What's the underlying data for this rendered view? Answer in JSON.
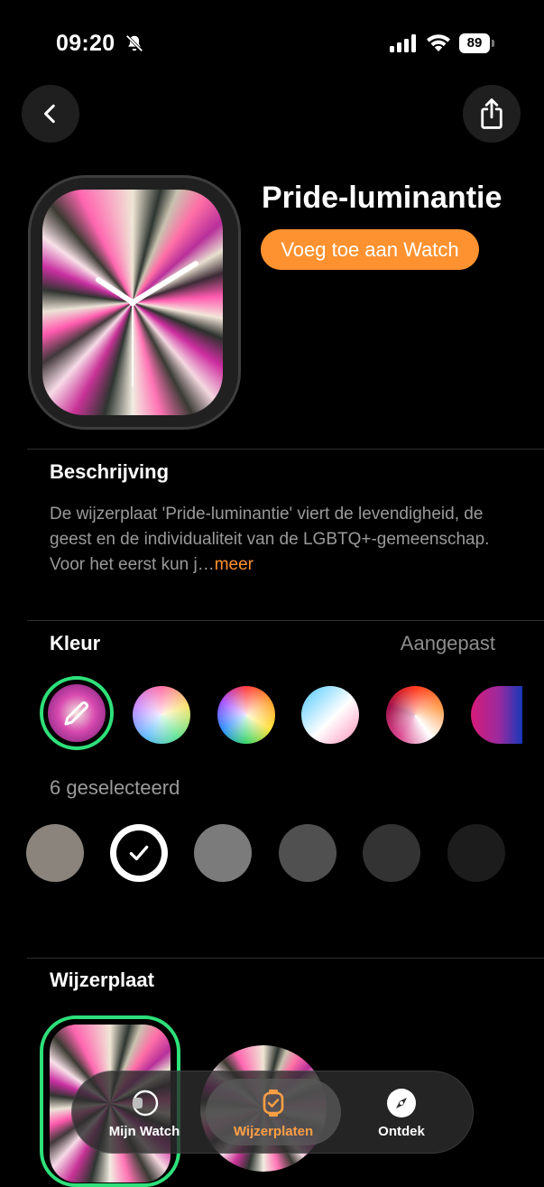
{
  "status_bar": {
    "time": "09:20",
    "battery": "89"
  },
  "header": {
    "back_label": "back",
    "share_label": "share"
  },
  "face": {
    "title": "Pride-luminantie",
    "add_button": "Voeg toe aan Watch"
  },
  "description": {
    "heading": "Beschrijving",
    "text": "De wijzerplaat 'Pride-luminantie' viert de levendigheid, de geest en de individualiteit van de LGBTQ+-gemeenschap. Voor het eerst kun j…",
    "more": "meer"
  },
  "color": {
    "heading": "Kleur",
    "mode": "Aangepast",
    "selected_count": "6 geselecteerd",
    "greys": [
      "#8a847c",
      "#ffffff",
      "#7b7b7b",
      "#505050",
      "#333333",
      "#1c1c1c"
    ]
  },
  "dial": {
    "heading": "Wijzerplaat"
  },
  "tabs": [
    {
      "label": "Mijn Watch",
      "icon": "watch-icon"
    },
    {
      "label": "Wijzerplaten",
      "icon": "watch-face-icon",
      "active": true
    },
    {
      "label": "Ontdek",
      "icon": "compass-icon"
    }
  ],
  "colors": {
    "accent": "#ff9230",
    "selection": "#2ee07a",
    "active_tab": "#ff9f45"
  }
}
